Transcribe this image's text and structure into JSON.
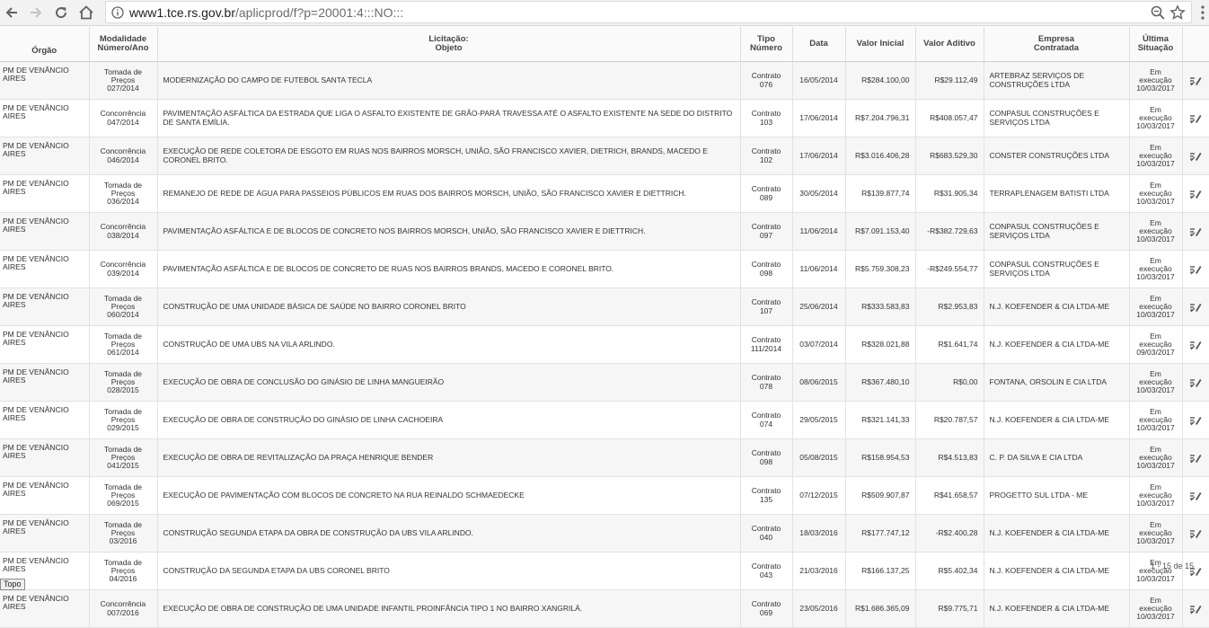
{
  "browser": {
    "url_host": "www1.tce.rs.gov.br",
    "url_path": "/aplicprod/f?p=20001:4:::NO:::"
  },
  "table": {
    "headers": {
      "orgao": "Órgão",
      "modalidade": "Modalidade\nNúmero/Ano",
      "licitacao": "Licitação:\nObjeto",
      "tipo": "Tipo\nNúmero",
      "data": "Data",
      "valor_inicial": "Valor Inicial",
      "valor_aditivo": "Valor Aditivo",
      "empresa": "Empresa\nContratada",
      "situacao": "Última\nSituação"
    },
    "rows": [
      {
        "orgao": "PM DE VENÂNCIO AIRES",
        "modalidade": "Tomada de\nPreços\n027/2014",
        "objeto": "MODERNIZAÇÃO DO CAMPO DE FUTEBOL SANTA TECLA",
        "tipo": "Contrato\n076",
        "data": "16/05/2014",
        "valor_inicial": "R$284.100,00",
        "valor_aditivo": "R$29.112,49",
        "empresa": "ARTEBRAZ SERVIÇOS DE CONSTRUÇÕES LTDA",
        "situacao": "Em\nexecução\n10/03/2017"
      },
      {
        "orgao": "PM DE VENÂNCIO AIRES",
        "modalidade": "Concorrência\n047/2014",
        "objeto": "PAVIMENTAÇÃO ASFÁLTICA DA ESTRADA QUE LIGA O ASFALTO EXISTENTE DE GRÃO-PARÁ TRAVESSA ATÉ O ASFALTO EXISTENTE NA SEDE DO DISTRITO DE SANTA EMÍLIA.",
        "tipo": "Contrato\n103",
        "data": "17/06/2014",
        "valor_inicial": "R$7.204.796,31",
        "valor_aditivo": "R$408.057,47",
        "empresa": "CONPASUL CONSTRUÇÕES E SERVIÇOS LTDA",
        "situacao": "Em\nexecução\n10/03/2017"
      },
      {
        "orgao": "PM DE VENÂNCIO AIRES",
        "modalidade": "Concorrência\n046/2014",
        "objeto": "EXECUÇÃO DE REDE COLETORA DE ESGOTO EM RUAS NOS BAIRROS MORSCH, UNIÃO, SÃO FRANCISCO XAVIER, DIETRICH, BRANDS, MACEDO E CORONEL BRITO.",
        "tipo": "Contrato\n102",
        "data": "17/06/2014",
        "valor_inicial": "R$3.016.406,28",
        "valor_aditivo": "R$683.529,30",
        "empresa": "CONSTER CONSTRUÇÕES LTDA",
        "situacao": "Em\nexecução\n10/03/2017"
      },
      {
        "orgao": "PM DE VENÂNCIO AIRES",
        "modalidade": "Tomada de\nPreços\n036/2014",
        "objeto": "REMANEJO DE REDE DE ÁGUA PARA PASSEIOS PÚBLICOS EM RUAS DOS BAIRROS MORSCH, UNIÃO, SÃO FRANCISCO XAVIER E DIETTRICH.",
        "tipo": "Contrato\n089",
        "data": "30/05/2014",
        "valor_inicial": "R$139.877,74",
        "valor_aditivo": "R$31.905,34",
        "empresa": "TERRAPLENAGEM BATISTI LTDA",
        "situacao": "Em\nexecução\n10/03/2017"
      },
      {
        "orgao": "PM DE VENÂNCIO AIRES",
        "modalidade": "Concorrência\n038/2014",
        "objeto": "PAVIMENTAÇÃO ASFÁLTICA E DE BLOCOS DE CONCRETO NOS BAIRROS MORSCH, UNIÃO, SÃO FRANCISCO XAVIER E DIETTRICH.",
        "tipo": "Contrato\n097",
        "data": "11/06/2014",
        "valor_inicial": "R$7.091.153,40",
        "valor_aditivo": "-R$382.729,63",
        "empresa": "CONPASUL CONSTRUÇÕES E SERVIÇOS LTDA",
        "situacao": "Em\nexecução\n10/03/2017"
      },
      {
        "orgao": "PM DE VENÂNCIO AIRES",
        "modalidade": "Concorrência\n039/2014",
        "objeto": "PAVIMENTAÇÃO ASFÁLTICA E DE BLOCOS DE CONCRETO DE RUAS NOS BAIRROS BRANDS, MACEDO E CORONEL BRITO.",
        "tipo": "Contrato\n098",
        "data": "11/06/2014",
        "valor_inicial": "R$5.759.308,23",
        "valor_aditivo": "-R$249.554,77",
        "empresa": "CONPASUL CONSTRUÇÕES E SERVIÇOS LTDA",
        "situacao": "Em\nexecução\n10/03/2017"
      },
      {
        "orgao": "PM DE VENÂNCIO AIRES",
        "modalidade": "Tomada de\nPreços\n060/2014",
        "objeto": "CONSTRUÇÃO DE UMA UNIDADE BÁSICA DE SAÚDE NO BAIRRO CORONEL BRITO",
        "tipo": "Contrato\n107",
        "data": "25/06/2014",
        "valor_inicial": "R$333.583,83",
        "valor_aditivo": "R$2.953,83",
        "empresa": "N.J. KOEFENDER & CIA LTDA-ME",
        "situacao": "Em\nexecução\n10/03/2017"
      },
      {
        "orgao": "PM DE VENÂNCIO AIRES",
        "modalidade": "Tomada de\nPreços\n061/2014",
        "objeto": "CONSTRUÇÃO DE UMA UBS NA VILA ARLINDO.",
        "tipo": "Contrato\n111/2014",
        "data": "03/07/2014",
        "valor_inicial": "R$328.021,88",
        "valor_aditivo": "R$1.641,74",
        "empresa": "N.J. KOEFENDER & CIA LTDA-ME",
        "situacao": "Em\nexecução\n09/03/2017"
      },
      {
        "orgao": "PM DE VENÂNCIO AIRES",
        "modalidade": "Tomada de\nPreços\n028/2015",
        "objeto": "EXECUÇÃO DE OBRA DE CONCLUSÃO DO GINÁSIO DE LINHA MANGUEIRÃO",
        "tipo": "Contrato\n078",
        "data": "08/06/2015",
        "valor_inicial": "R$367.480,10",
        "valor_aditivo": "R$0,00",
        "empresa": "FONTANA, ORSOLIN E CIA LTDA",
        "situacao": "Em\nexecução\n10/03/2017"
      },
      {
        "orgao": "PM DE VENÂNCIO AIRES",
        "modalidade": "Tomada de\nPreços\n029/2015",
        "objeto": "EXECUÇÃO DE OBRA DE CONSTRUÇÃO DO GINÁSIO DE LINHA CACHOEIRA",
        "tipo": "Contrato\n074",
        "data": "29/05/2015",
        "valor_inicial": "R$321.141,33",
        "valor_aditivo": "R$20.787,57",
        "empresa": "N.J. KOEFENDER & CIA LTDA-ME",
        "situacao": "Em\nexecução\n10/03/2017"
      },
      {
        "orgao": "PM DE VENÂNCIO AIRES",
        "modalidade": "Tomada de\nPreços\n041/2015",
        "objeto": "EXECUÇÃO DE OBRA DE REVITALIZAÇÃO DA PRAÇA HENRIQUE BENDER",
        "tipo": "Contrato\n098",
        "data": "05/08/2015",
        "valor_inicial": "R$158.954,53",
        "valor_aditivo": "R$4.513,83",
        "empresa": "C. P. DA SILVA E CIA LTDA",
        "situacao": "Em\nexecução\n10/03/2017"
      },
      {
        "orgao": "PM DE VENÂNCIO AIRES",
        "modalidade": "Tomada de\nPreços\n069/2015",
        "objeto": "EXECUÇÃO DE PAVIMENTAÇÃO COM BLOCOS DE CONCRETO NA RUA REINALDO SCHMAEDECKE",
        "tipo": "Contrato\n135",
        "data": "07/12/2015",
        "valor_inicial": "R$509.907,87",
        "valor_aditivo": "R$41.658,57",
        "empresa": "PROGETTO SUL LTDA - ME",
        "situacao": "Em\nexecução\n10/03/2017"
      },
      {
        "orgao": "PM DE VENÂNCIO AIRES",
        "modalidade": "Tomada de\nPreços\n03/2016",
        "objeto": "CONSTRUÇÃO SEGUNDA ETAPA DA OBRA DE CONSTRUÇÃO DA UBS VILA ARLINDO.",
        "tipo": "Contrato\n040",
        "data": "18/03/2016",
        "valor_inicial": "R$177.747,12",
        "valor_aditivo": "-R$2.400,28",
        "empresa": "N.J. KOEFENDER & CIA LTDA-ME",
        "situacao": "Em\nexecução\n10/03/2017"
      },
      {
        "orgao": "PM DE VENÂNCIO AIRES",
        "modalidade": "Tomada de\nPreços\n04/2016",
        "objeto": "CONSTRUÇÃO DA SEGUNDA ETAPA DA UBS CORONEL BRITO",
        "tipo": "Contrato\n043",
        "data": "21/03/2016",
        "valor_inicial": "R$166.137,25",
        "valor_aditivo": "R$5.402,34",
        "empresa": "N.J. KOEFENDER & CIA LTDA-ME",
        "situacao": "Em\nexecução\n10/03/2017"
      },
      {
        "orgao": "PM DE VENÂNCIO AIRES",
        "modalidade": "Concorrência\n007/2016",
        "objeto": "EXECUÇÃO DE OBRA DE CONSTRUÇÃO DE UMA UNIDADE INFANTIL PROINFÂNCIA TIPO 1 NO BAIRRO XANGRILÁ.",
        "tipo": "Contrato\n069",
        "data": "23/05/2016",
        "valor_inicial": "R$1.686.365,09",
        "valor_aditivo": "R$9.775,71",
        "empresa": "N.J. KOEFENDER & CIA LTDA-ME",
        "situacao": "Em\nexecução\n10/03/2017"
      }
    ]
  },
  "pagination": {
    "label": "1 - 15 de 15"
  },
  "footer": {
    "topo_label": "Topo"
  },
  "icons": {
    "row_action": "edit-details-icon"
  }
}
